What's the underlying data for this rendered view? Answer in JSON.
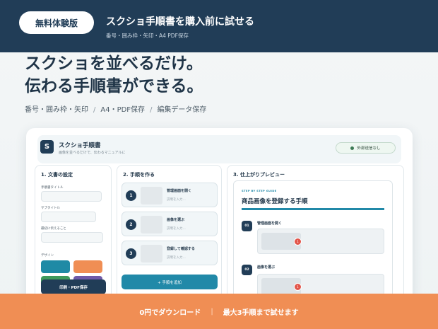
{
  "banner": {
    "badge": "無料体験版",
    "title": "スクショ手順書を購入前に試せる",
    "subtitle": "番号・囲み枠・矢印・A4 PDF保存"
  },
  "hero": {
    "line1": "スクショを並べるだけ。",
    "line2": "伝わる手順書ができる。"
  },
  "features": [
    "番号・囲み枠・矢印",
    "A4・PDF保存",
    "編集データ保存"
  ],
  "feature_separator": "/",
  "app": {
    "logo_letter": "S",
    "title": "スクショ手順書",
    "subtitle": "画像を並べるだけで、伝わるマニュアルに",
    "status": "外部送信なし",
    "doc_panel": {
      "title": "1. 文書の設定",
      "fields": [
        "手順書タイトル",
        "サブタイトル",
        "最初に伝えること"
      ],
      "design_label": "デザイン",
      "swatches": [
        "#1f8aa5",
        "#f08e54",
        "#3f9a5c",
        "#6f5aa8"
      ],
      "print_button": "印刷・PDF保存"
    },
    "steps_panel": {
      "title": "2. 手順を作る",
      "steps": [
        {
          "num": "1",
          "title": "管理画面を開く",
          "desc": "説明を入力..."
        },
        {
          "num": "2",
          "title": "画像を選ぶ",
          "desc": "説明を入力..."
        },
        {
          "num": "3",
          "title": "登録して確認する",
          "desc": "説明を入力..."
        }
      ],
      "add_button": "+ 手順を追加"
    },
    "preview_panel": {
      "title": "3. 仕上がりプレビュー",
      "guide_label": "STEP BY STEP GUIDE",
      "doc_title": "商品画像を登録する手順",
      "steps": [
        {
          "num": "01",
          "title": "管理画面を開く",
          "marker": "1"
        },
        {
          "num": "02",
          "title": "画像を選ぶ",
          "marker": "1"
        }
      ]
    }
  },
  "footer": {
    "left": "0円でダウンロード",
    "separator": "|",
    "right": "最大3手順まで試せます"
  }
}
